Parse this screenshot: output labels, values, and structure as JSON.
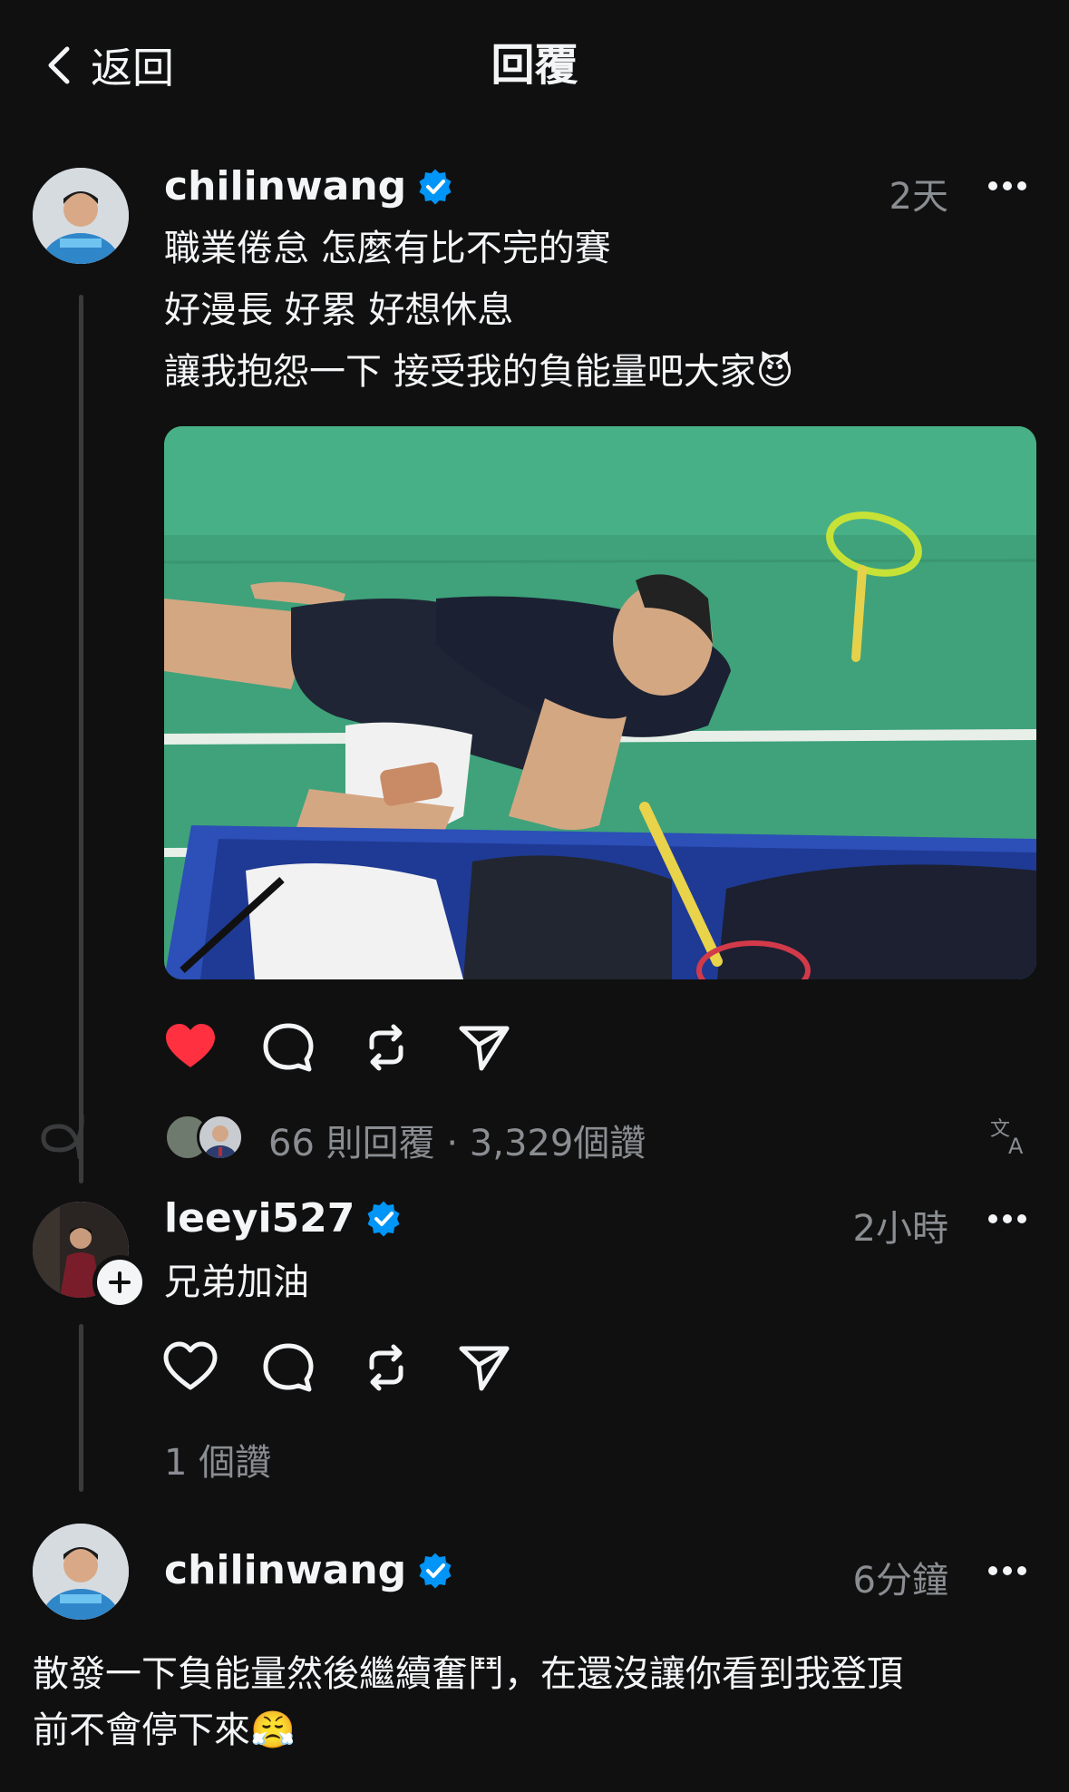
{
  "header": {
    "back_label": "返回",
    "title": "回覆"
  },
  "post": {
    "username": "chilinwang",
    "time": "2天",
    "lines": [
      "職業倦怠 怎麼有比不完的賽",
      "好漫長 好累 好想休息",
      "讓我抱怨一下 接受我的負能量吧大家😈"
    ],
    "stats": {
      "replies": "66 則回覆",
      "separator": "·",
      "likes": "3,329個讚"
    }
  },
  "reply1": {
    "username": "leeyi527",
    "time": "2小時",
    "text": "兄弟加油",
    "likes": "1 個讚"
  },
  "reply2": {
    "username": "chilinwang",
    "time": "6分鐘",
    "lines": [
      "散發一下負能量然後繼續奮鬥，在還沒讓你看到我登頂",
      "前不會停下來😤"
    ]
  },
  "colors": {
    "background": "#101010",
    "text": "#f3f5f7",
    "muted": "#8a8d91",
    "verified": "#0095f6",
    "like": "#ff3040"
  },
  "icons": {
    "back": "chevron-left-icon",
    "verified": "verified-badge-icon",
    "more": "more-dots-icon",
    "like": "heart-icon",
    "comment": "comment-icon",
    "repost": "repost-icon",
    "share": "send-icon",
    "translate": "translate-icon",
    "follow": "plus-icon"
  }
}
